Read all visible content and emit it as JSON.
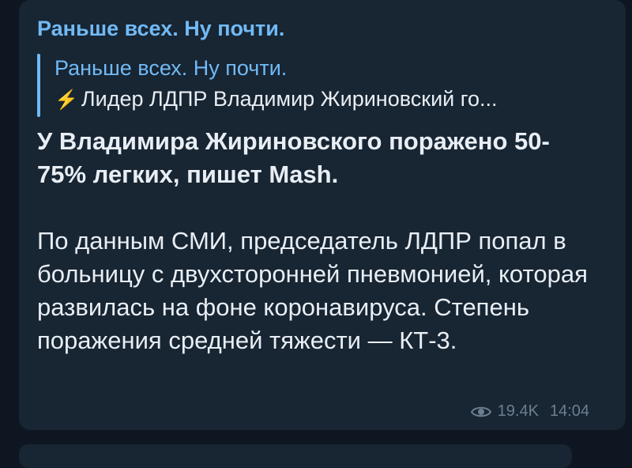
{
  "post": {
    "channel_name": "Раньше всех. Ну почти.",
    "forwarded": {
      "title": "Раньше всех. Ну почти.",
      "preview": "Лидер ЛДПР Владимир Жириновский го..."
    },
    "headline": "У Владимира Жириновского поражено 50-75% легких, пишет Mash.",
    "body": "По данным СМИ, председатель ЛДПР попал в больницу с двухсторонней пневмонией, которая развилась на фоне коронавируса. Степень поражения средней тяжести — КТ-3.",
    "views": "19.4K",
    "time": "14:04"
  },
  "colors": {
    "background": "#0e1621",
    "bubble": "#182533",
    "accent": "#71baf5",
    "text": "#e8eef4",
    "meta": "#6d7f8f",
    "lightning": "#f6c343"
  },
  "icons": {
    "reply_prefix": "lightning-icon",
    "views": "eye-icon"
  }
}
